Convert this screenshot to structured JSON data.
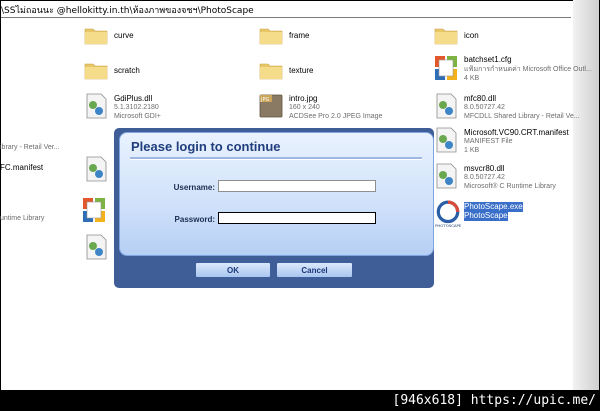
{
  "address": "\\SSไม่ถอนนะ @hellokitty.in.th\\ห้องภาพของจชฯ\\PhotoScape",
  "files": {
    "curve": {
      "name": "curve"
    },
    "frame": {
      "name": "frame"
    },
    "icon": {
      "name": "icon"
    },
    "scratch": {
      "name": "scratch"
    },
    "texture": {
      "name": "texture"
    },
    "batchset": {
      "name": "batchset1.cfg",
      "line1": "แฟ้มการกำหนดค่า Microsoft Office Outl...",
      "line2": "4 KB"
    },
    "gdiplus": {
      "name": "GdiPlus.dll",
      "line1": "5.1.3102.2180",
      "line2": "Microsoft GDI+"
    },
    "intro": {
      "name": "intro.jpg",
      "line1": "160 x 240",
      "line2": "ACDSee Pro 2.0 JPEG Image",
      "badge": "JPG"
    },
    "mfc80": {
      "name": "mfc80.dll",
      "line1": "8.0.50727.42",
      "line2": "MFCDLL Shared Library - Retail Ve..."
    },
    "vc90": {
      "name": "Microsoft.VC90.CRT.manifest",
      "line1": "MANIFEST File",
      "line2": "1 KB"
    },
    "msvcr80": {
      "name": "msvcr80.dll",
      "line1": "8.0.50727.42",
      "line2": "Microsoft® C Runtime Library"
    },
    "photoscape": {
      "name": "PhotoScape.exe",
      "line1": "PhotoScape",
      "logo_text": "PHOTOSCAPE"
    }
  },
  "left_fragments": {
    "retail": "ibrary - Retail Ver...",
    "manifest": "FC.manifest",
    "runtime": "untime Library"
  },
  "dialog": {
    "title": "Please login to continue",
    "username_label": "Username:",
    "password_label": "Password:",
    "username_value": "",
    "password_value": "",
    "ok_label": "OK",
    "cancel_label": "Cancel"
  },
  "watermark": "[946x618] https://upic.me/",
  "colors": {
    "accent": "#203e7d",
    "selection": "#3a6fc9",
    "folder": "#f2d77c"
  }
}
